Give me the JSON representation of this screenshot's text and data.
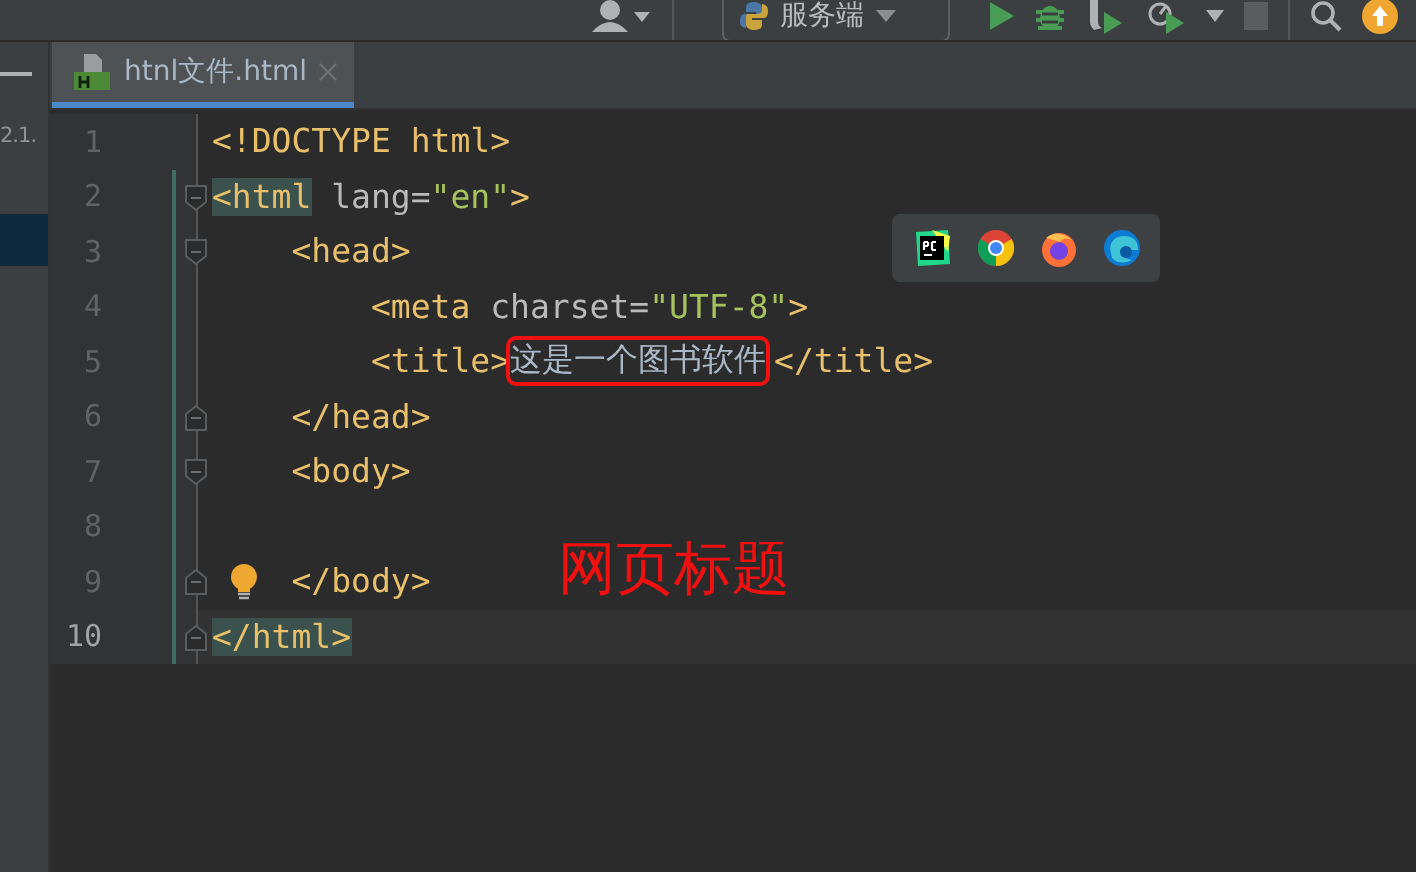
{
  "toolbar": {
    "run_config": "服务端"
  },
  "sidebar": {
    "items": [
      {
        "label": "2.1.",
        "selected": false
      },
      {
        "selected": true
      }
    ]
  },
  "tabs": [
    {
      "label": "htnl文件.html",
      "selected": true
    }
  ],
  "editor": {
    "lines": [
      {
        "number": "1",
        "current": false,
        "fold_start": false,
        "fold_end": false,
        "bulb": false,
        "tokens": [
          {
            "text": "<!DOCTYPE html>",
            "kind": "tag"
          }
        ]
      },
      {
        "number": "2",
        "current": false,
        "fold_start": true,
        "fold_end": false,
        "bulb": false,
        "tokens": [
          {
            "text": "<html",
            "kind": "tag-matched"
          },
          {
            "text": " lang",
            "kind": "attr"
          },
          {
            "text": "=",
            "kind": "attr"
          },
          {
            "text": "\"en\"",
            "kind": "value"
          },
          {
            "text": ">",
            "kind": "tag"
          }
        ]
      },
      {
        "number": "3",
        "current": false,
        "fold_start": true,
        "fold_end": false,
        "bulb": false,
        "tokens": [
          {
            "text": "    <head>",
            "kind": "tag"
          }
        ]
      },
      {
        "number": "4",
        "current": false,
        "fold_start": false,
        "fold_end": false,
        "bulb": false,
        "tokens": [
          {
            "text": "        <meta",
            "kind": "tag"
          },
          {
            "text": " charset",
            "kind": "attr"
          },
          {
            "text": "=",
            "kind": "attr"
          },
          {
            "text": "\"UTF-8\"",
            "kind": "value"
          },
          {
            "text": ">",
            "kind": "tag"
          }
        ]
      },
      {
        "number": "5",
        "current": false,
        "fold_start": false,
        "fold_end": false,
        "bulb": false,
        "tokens": [
          {
            "text": "        <title>",
            "kind": "tag"
          },
          {
            "text": "这是一个图书软件",
            "kind": "text-boxed"
          },
          {
            "text": "</title>",
            "kind": "tag"
          }
        ]
      },
      {
        "number": "6",
        "current": false,
        "fold_start": false,
        "fold_end": true,
        "bulb": false,
        "tokens": [
          {
            "text": "    </head>",
            "kind": "tag"
          }
        ]
      },
      {
        "number": "7",
        "current": false,
        "fold_start": true,
        "fold_end": false,
        "bulb": false,
        "tokens": [
          {
            "text": "    <body>",
            "kind": "tag"
          }
        ]
      },
      {
        "number": "8",
        "current": false,
        "fold_start": false,
        "fold_end": false,
        "bulb": false
      },
      {
        "number": "9",
        "current": false,
        "fold_start": false,
        "fold_end": true,
        "bulb": true,
        "tokens": [
          {
            "text": "    </body>",
            "kind": "tag"
          }
        ]
      },
      {
        "number": "10",
        "current": true,
        "fold_start": false,
        "fold_end": true,
        "bulb": false,
        "tokens": [
          {
            "text": "</html>",
            "kind": "tag-matched"
          }
        ]
      }
    ]
  },
  "annotation": {
    "text": "网页标题"
  }
}
